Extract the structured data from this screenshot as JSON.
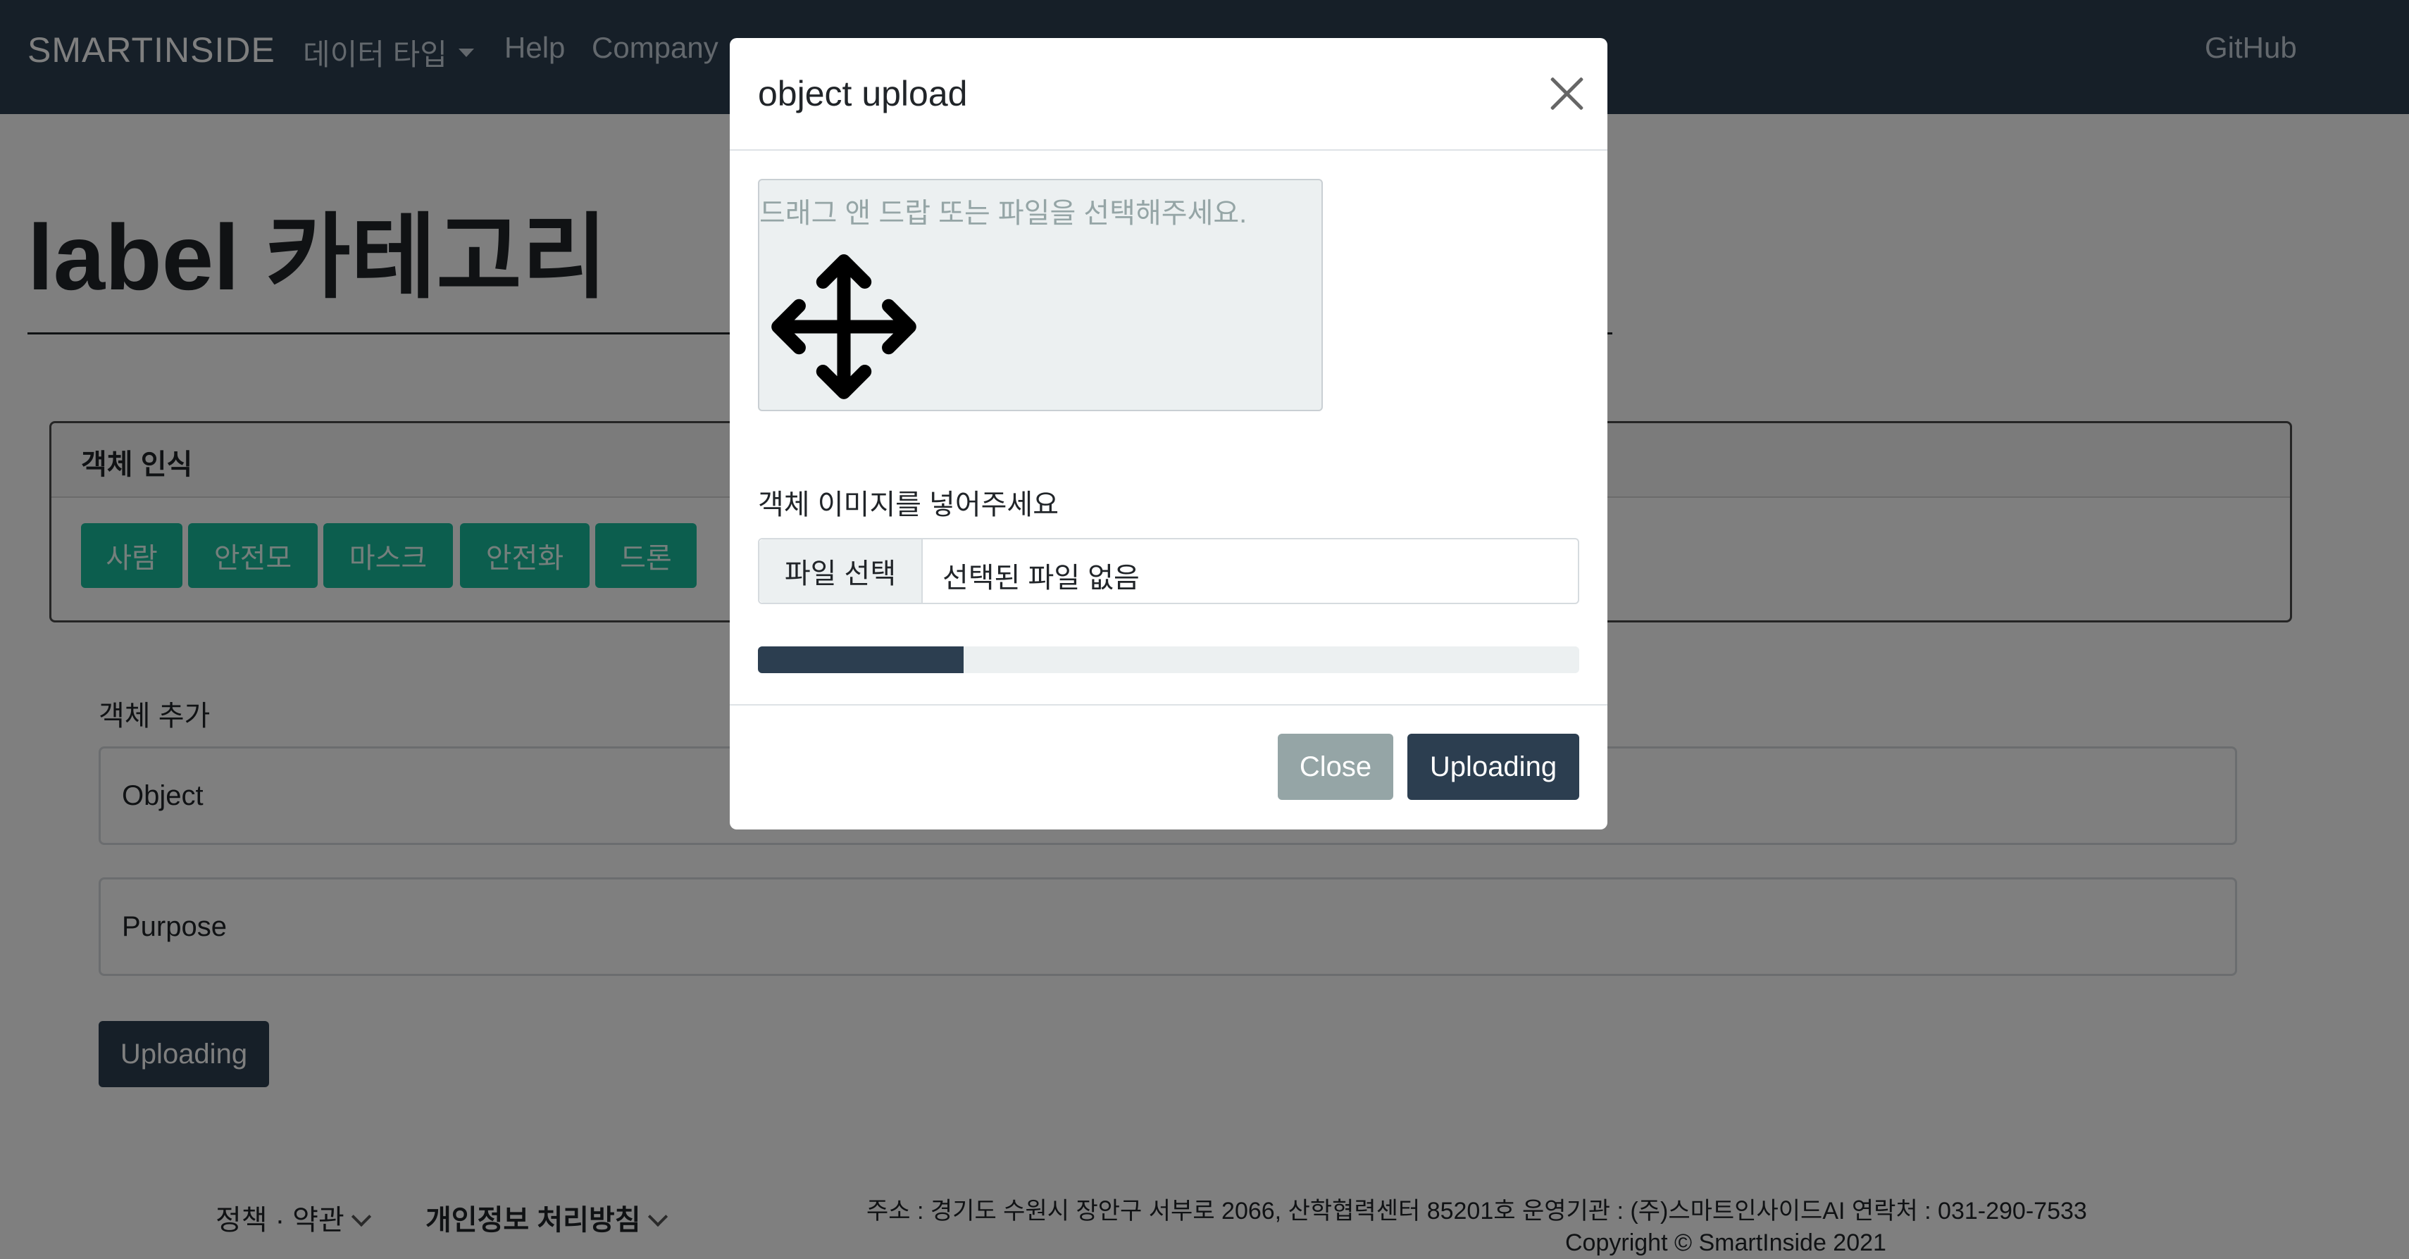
{
  "navbar": {
    "brand": "SMARTINSIDE",
    "items": [
      {
        "label": "데이터 타입"
      },
      {
        "label": "Help"
      },
      {
        "label": "Company"
      }
    ],
    "github": "GitHub"
  },
  "page": {
    "title": "label 카테고리"
  },
  "card": {
    "title": "객체 인식",
    "chips": [
      "사람",
      "안전모",
      "마스크",
      "안전화",
      "드론"
    ]
  },
  "add_form": {
    "label": "객체 추가",
    "object_placeholder": "Object",
    "purpose_placeholder": "Purpose",
    "submit_label": "Uploading"
  },
  "footer": {
    "policy": "정책 · 약관",
    "privacy": "개인정보 처리방침",
    "address": "주소 : 경기도 수원시 장안구 서부로 2066, 산학협력센터 85201호   운영기관 : (주)스마트인사이드AI   연락처 : 031-290-7533",
    "copyright": "Copyright © SmartInside 2021"
  },
  "modal": {
    "title": "object upload",
    "dropzone_text": "드래그 앤 드랍 또는 파일을 선택해주세요.",
    "dropzone_icon": "move-icon",
    "file_label": "객체 이미지를 넣어주세요",
    "file_button": "파일 선택",
    "file_name": "선택된 파일 없음",
    "progress_fraction": 0.25,
    "close_label": "Close",
    "upload_label": "Uploading"
  },
  "colors": {
    "primary": "#2c3e50",
    "success": "#18bc9c",
    "secondary": "#95a5a6",
    "light": "#ecf0f1"
  }
}
